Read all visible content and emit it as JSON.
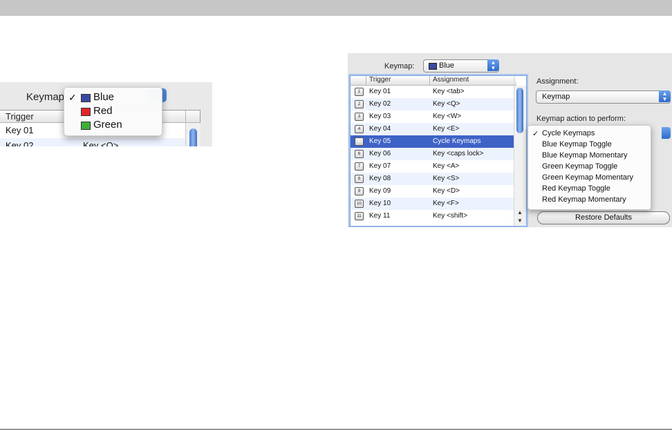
{
  "left_snippet": {
    "keymap_label": "Keymap",
    "columns": [
      "Trigger",
      ""
    ],
    "rows": [
      {
        "trigger": "Key 01",
        "assignment": ""
      },
      {
        "trigger": "Key 02",
        "assignment": "Key <Q>"
      }
    ],
    "menu": [
      {
        "check": "✓",
        "label": "Blue",
        "color": "#3a4aa2"
      },
      {
        "check": "",
        "label": "Red",
        "color": "#e0262a"
      },
      {
        "check": "",
        "label": "Green",
        "color": "#3fae3a"
      }
    ]
  },
  "panel": {
    "keymap_label": "Keymap:",
    "keymap_value": "Blue",
    "keymap_color": "#3a4aa2",
    "columns": [
      "Trigger",
      "Assignment"
    ],
    "rows": [
      {
        "num": "1",
        "trigger": "Key 01",
        "assignment": "Key <tab>"
      },
      {
        "num": "2",
        "trigger": "Key 02",
        "assignment": "Key <Q>"
      },
      {
        "num": "3",
        "trigger": "Key 03",
        "assignment": "Key <W>"
      },
      {
        "num": "4",
        "trigger": "Key 04",
        "assignment": "Key <E>"
      },
      {
        "num": "5",
        "trigger": "Key 05",
        "assignment": "Cycle Keymaps"
      },
      {
        "num": "6",
        "trigger": "Key 06",
        "assignment": "Key <caps lock>"
      },
      {
        "num": "7",
        "trigger": "Key 07",
        "assignment": "Key <A>"
      },
      {
        "num": "8",
        "trigger": "Key 08",
        "assignment": "Key <S>"
      },
      {
        "num": "9",
        "trigger": "Key 09",
        "assignment": "Key <D>"
      },
      {
        "num": "10",
        "trigger": "Key 10",
        "assignment": "Key <F>"
      },
      {
        "num": "11",
        "trigger": "Key 11",
        "assignment": "Key <shift>"
      }
    ],
    "selected_row": 4,
    "assignment_label": "Assignment:",
    "assignment_value": "Keymap",
    "action_label": "Keymap action to perform:",
    "action_options": [
      {
        "check": "✓",
        "label": "Cycle Keymaps"
      },
      {
        "check": "",
        "label": "Blue Keymap Toggle"
      },
      {
        "check": "",
        "label": "Blue Keymap Momentary"
      },
      {
        "check": "",
        "label": "Green Keymap Toggle"
      },
      {
        "check": "",
        "label": "Green Keymap Momentary"
      },
      {
        "check": "",
        "label": "Red Keymap Toggle"
      },
      {
        "check": "",
        "label": "Red Keymap Momentary"
      }
    ],
    "restore_label": "Restore Defaults"
  },
  "icons": {
    "popup_arrows": "up-down-chevron-icon",
    "scroll_up": "▲",
    "scroll_down": "▼"
  }
}
